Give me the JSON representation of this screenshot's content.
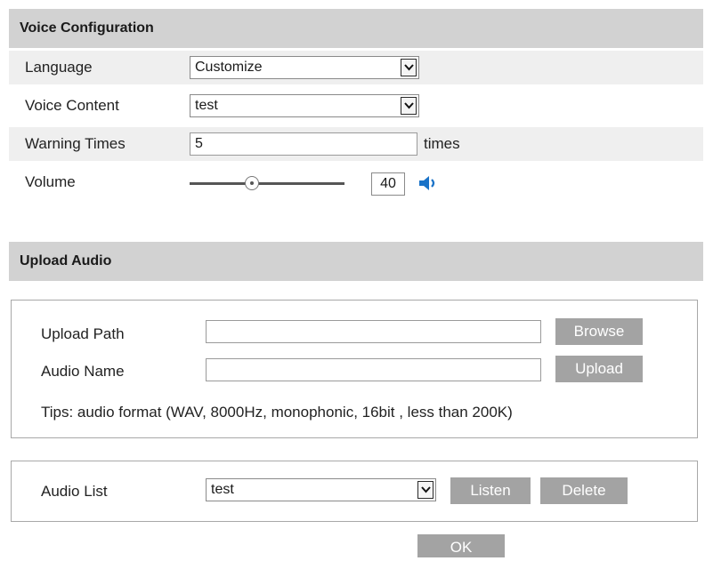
{
  "voice_config": {
    "header": "Voice Configuration",
    "language": {
      "label": "Language",
      "value": "Customize"
    },
    "voice_content": {
      "label": "Voice Content",
      "value": "test"
    },
    "warning_times": {
      "label": "Warning Times",
      "value": "5",
      "unit": "times"
    },
    "volume": {
      "label": "Volume",
      "value": "40",
      "level_percent": 40
    }
  },
  "upload_audio": {
    "header": "Upload Audio",
    "upload_path": {
      "label": "Upload Path",
      "value": "",
      "button": "Browse"
    },
    "audio_name": {
      "label": "Audio Name",
      "value": "",
      "button": "Upload"
    },
    "tips": "Tips: audio format (WAV, 8000Hz, monophonic, 16bit , less than 200K)"
  },
  "audio_list": {
    "label": "Audio List",
    "selected": "test",
    "listen_button": "Listen",
    "delete_button": "Delete"
  },
  "ok_button": "OK",
  "icons": {
    "dropdown": "chevron-down-icon",
    "speaker": "speaker-volume-icon"
  },
  "colors": {
    "header_bg": "#d2d2d2",
    "row_shade": "#efefef",
    "button_bg": "#a3a3a3",
    "speaker_blue": "#1a73c8"
  }
}
